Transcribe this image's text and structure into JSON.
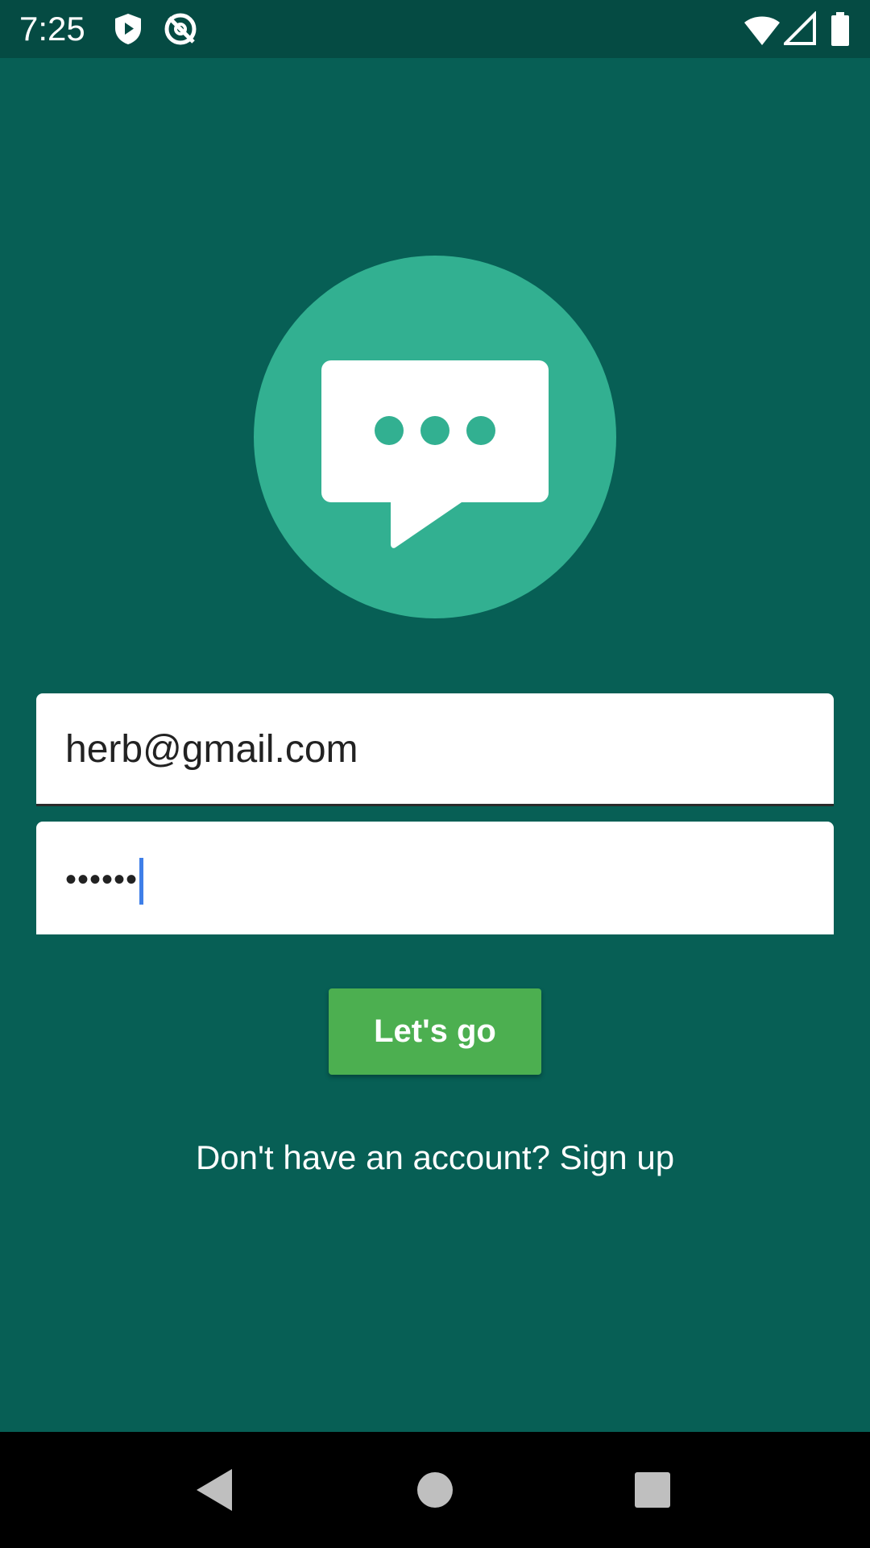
{
  "status_bar": {
    "time": "7:25",
    "icons": [
      "shield-play-icon",
      "no-signal-circle-icon",
      "wifi-icon",
      "cellular-signal-icon",
      "battery-icon"
    ]
  },
  "app": {
    "logo_icon": "chat-bubble-icon",
    "colors": {
      "background": "#075f55",
      "status_bar": "#054b43",
      "logo_circle": "#32b091",
      "button": "#4caf50",
      "caret": "#3f7fe8"
    }
  },
  "login": {
    "email_value": "herb@gmail.com",
    "password_value": "••••••",
    "submit_label": "Let's go",
    "signup_text": "Don't have an account? Sign up"
  },
  "nav_bar": {
    "buttons": [
      "back-icon",
      "home-icon",
      "recents-icon"
    ]
  }
}
